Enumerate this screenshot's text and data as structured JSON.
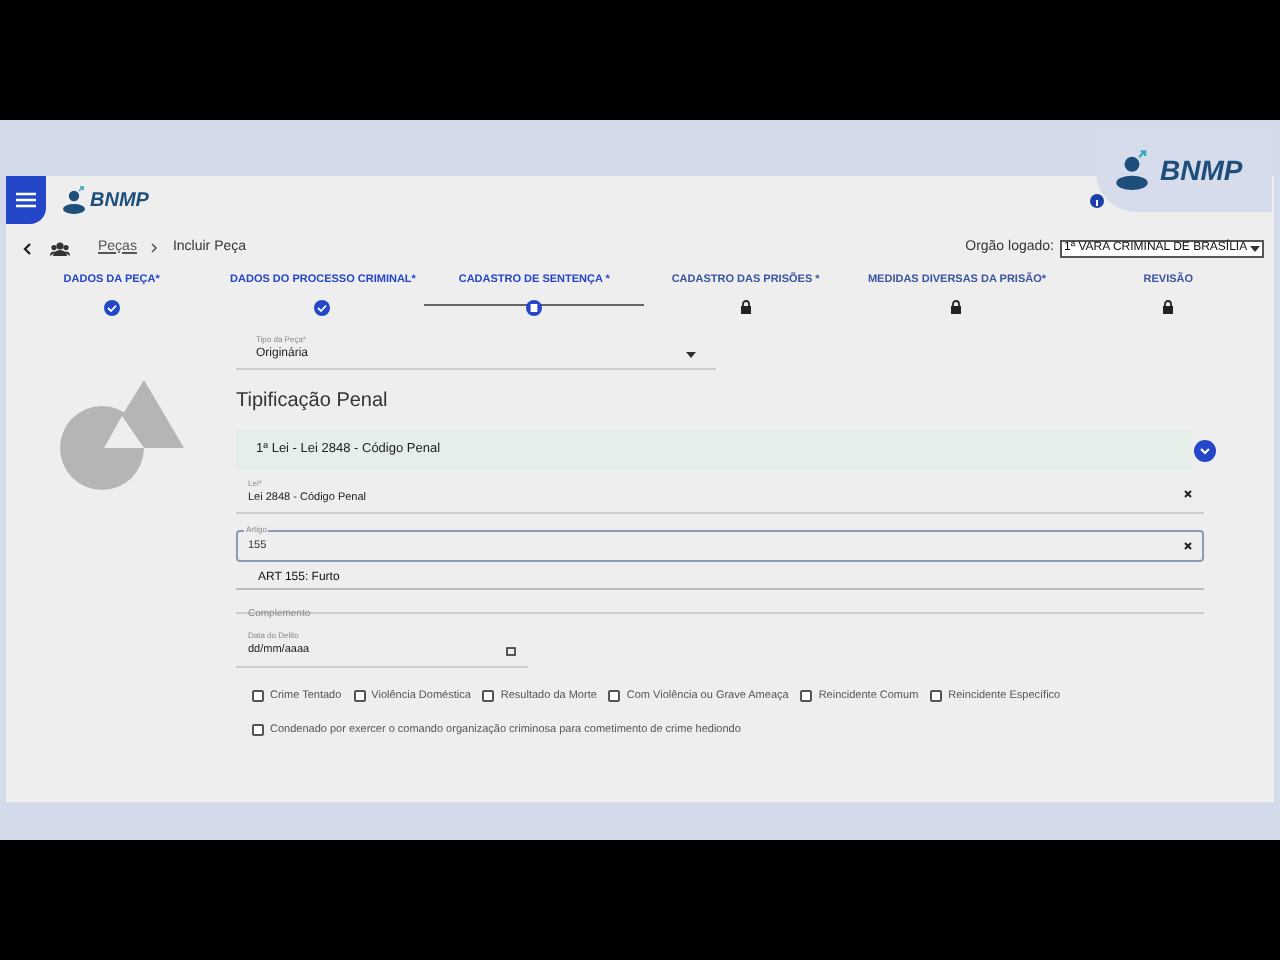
{
  "header": {
    "logo": "BNMP",
    "corner_logo": "BNMP"
  },
  "breadcrumb": {
    "items": [
      "Peças",
      "Incluir Peça"
    ],
    "org_label": "Orgão logado:",
    "org_value": "1ª VARA CRIMINAL DE BRASÍLIA"
  },
  "steps": [
    {
      "label": "DADOS DA PEÇA*",
      "kind": "done",
      "selected": false
    },
    {
      "label": "DADOS DO PROCESSO CRIMINAL*",
      "kind": "done",
      "selected": false
    },
    {
      "label": "CADASTRO DE SENTENÇA *",
      "kind": "current",
      "selected": true
    },
    {
      "label": "CADASTRO DAS PRISÕES *",
      "kind": "locked",
      "selected": false
    },
    {
      "label": "MEDIDAS DIVERSAS DA PRISÃO*",
      "kind": "locked",
      "selected": false
    },
    {
      "label": "REVISÃO",
      "kind": "locked",
      "selected": false
    }
  ],
  "tipo_peca": {
    "label": "Tipo da Peça*",
    "value": "Originária"
  },
  "section_title": "Tipificação Penal",
  "accordion": {
    "title": "1ª Lei - Lei 2848 - Código Penal",
    "expanded": true
  },
  "lei": {
    "label": "Lei*",
    "value": "Lei 2848 - Código Penal"
  },
  "artigo": {
    "label": "Artigo",
    "value": "155",
    "suggestion": "ART 155: Furto"
  },
  "complemento": {
    "placeholder": "Complemento"
  },
  "data_delito": {
    "label": "Data do Delito",
    "value": "dd/mm/aaaa"
  },
  "checkboxes": [
    {
      "label": "Crime Tentado",
      "checked": false
    },
    {
      "label": "Violência Doméstica",
      "checked": false
    },
    {
      "label": "Resultado da Morte",
      "checked": false
    },
    {
      "label": "Com Violência ou Grave Ameaça",
      "checked": false
    },
    {
      "label": "Reincidente Comum",
      "checked": false
    },
    {
      "label": "Reincidente Específico",
      "checked": false
    }
  ],
  "checkbox_full": {
    "label": "Condenado por exercer o comando organização criminosa para cometimento de crime hediondo",
    "checked": false
  }
}
